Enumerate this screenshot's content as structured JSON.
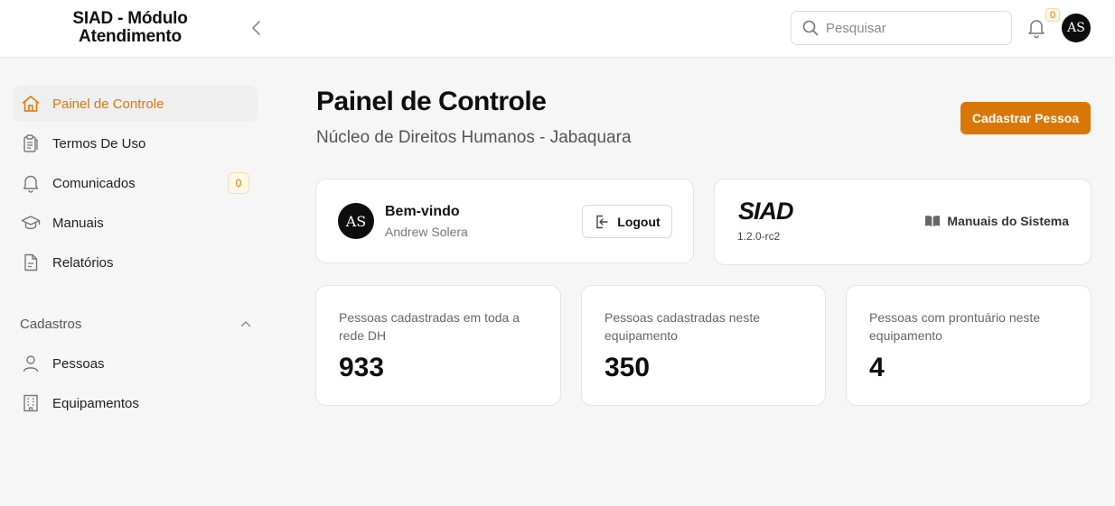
{
  "header": {
    "brand": "SIAD - Módulo Atendimento",
    "search_placeholder": "Pesquisar",
    "notification_count": "0",
    "avatar_initials": "AS"
  },
  "sidebar": {
    "items": [
      {
        "label": "Painel de Controle",
        "icon": "home-icon",
        "active": true
      },
      {
        "label": "Termos De Uso",
        "icon": "clipboard-icon"
      },
      {
        "label": "Comunicados",
        "icon": "bell-icon",
        "badge": "0"
      },
      {
        "label": "Manuais",
        "icon": "graduation-cap-icon"
      },
      {
        "label": "Relatórios",
        "icon": "document-icon"
      }
    ],
    "section": {
      "title": "Cadastros",
      "items": [
        {
          "label": "Pessoas",
          "icon": "user-icon"
        },
        {
          "label": "Equipamentos",
          "icon": "building-icon"
        }
      ]
    }
  },
  "main": {
    "title": "Painel de Controle",
    "subtitle": "Núcleo de Direitos Humanos - Jabaquara",
    "primary_action": "Cadastrar Pessoa",
    "welcome": {
      "avatar_initials": "AS",
      "title": "Bem-vindo",
      "name": "Andrew Solera",
      "logout_label": "Logout"
    },
    "system": {
      "logo": "SIAD",
      "version": "1.2.0-rc2",
      "manuals_label": "Manuais do Sistema"
    },
    "stats": [
      {
        "label": "Pessoas cadastradas em toda a rede DH",
        "value": "933"
      },
      {
        "label": "Pessoas cadastradas neste equipamento",
        "value": "350"
      },
      {
        "label": "Pessoas com prontuário neste equipamento",
        "value": "4"
      }
    ]
  },
  "colors": {
    "accent": "#d97706",
    "background": "#f6f6f6"
  }
}
